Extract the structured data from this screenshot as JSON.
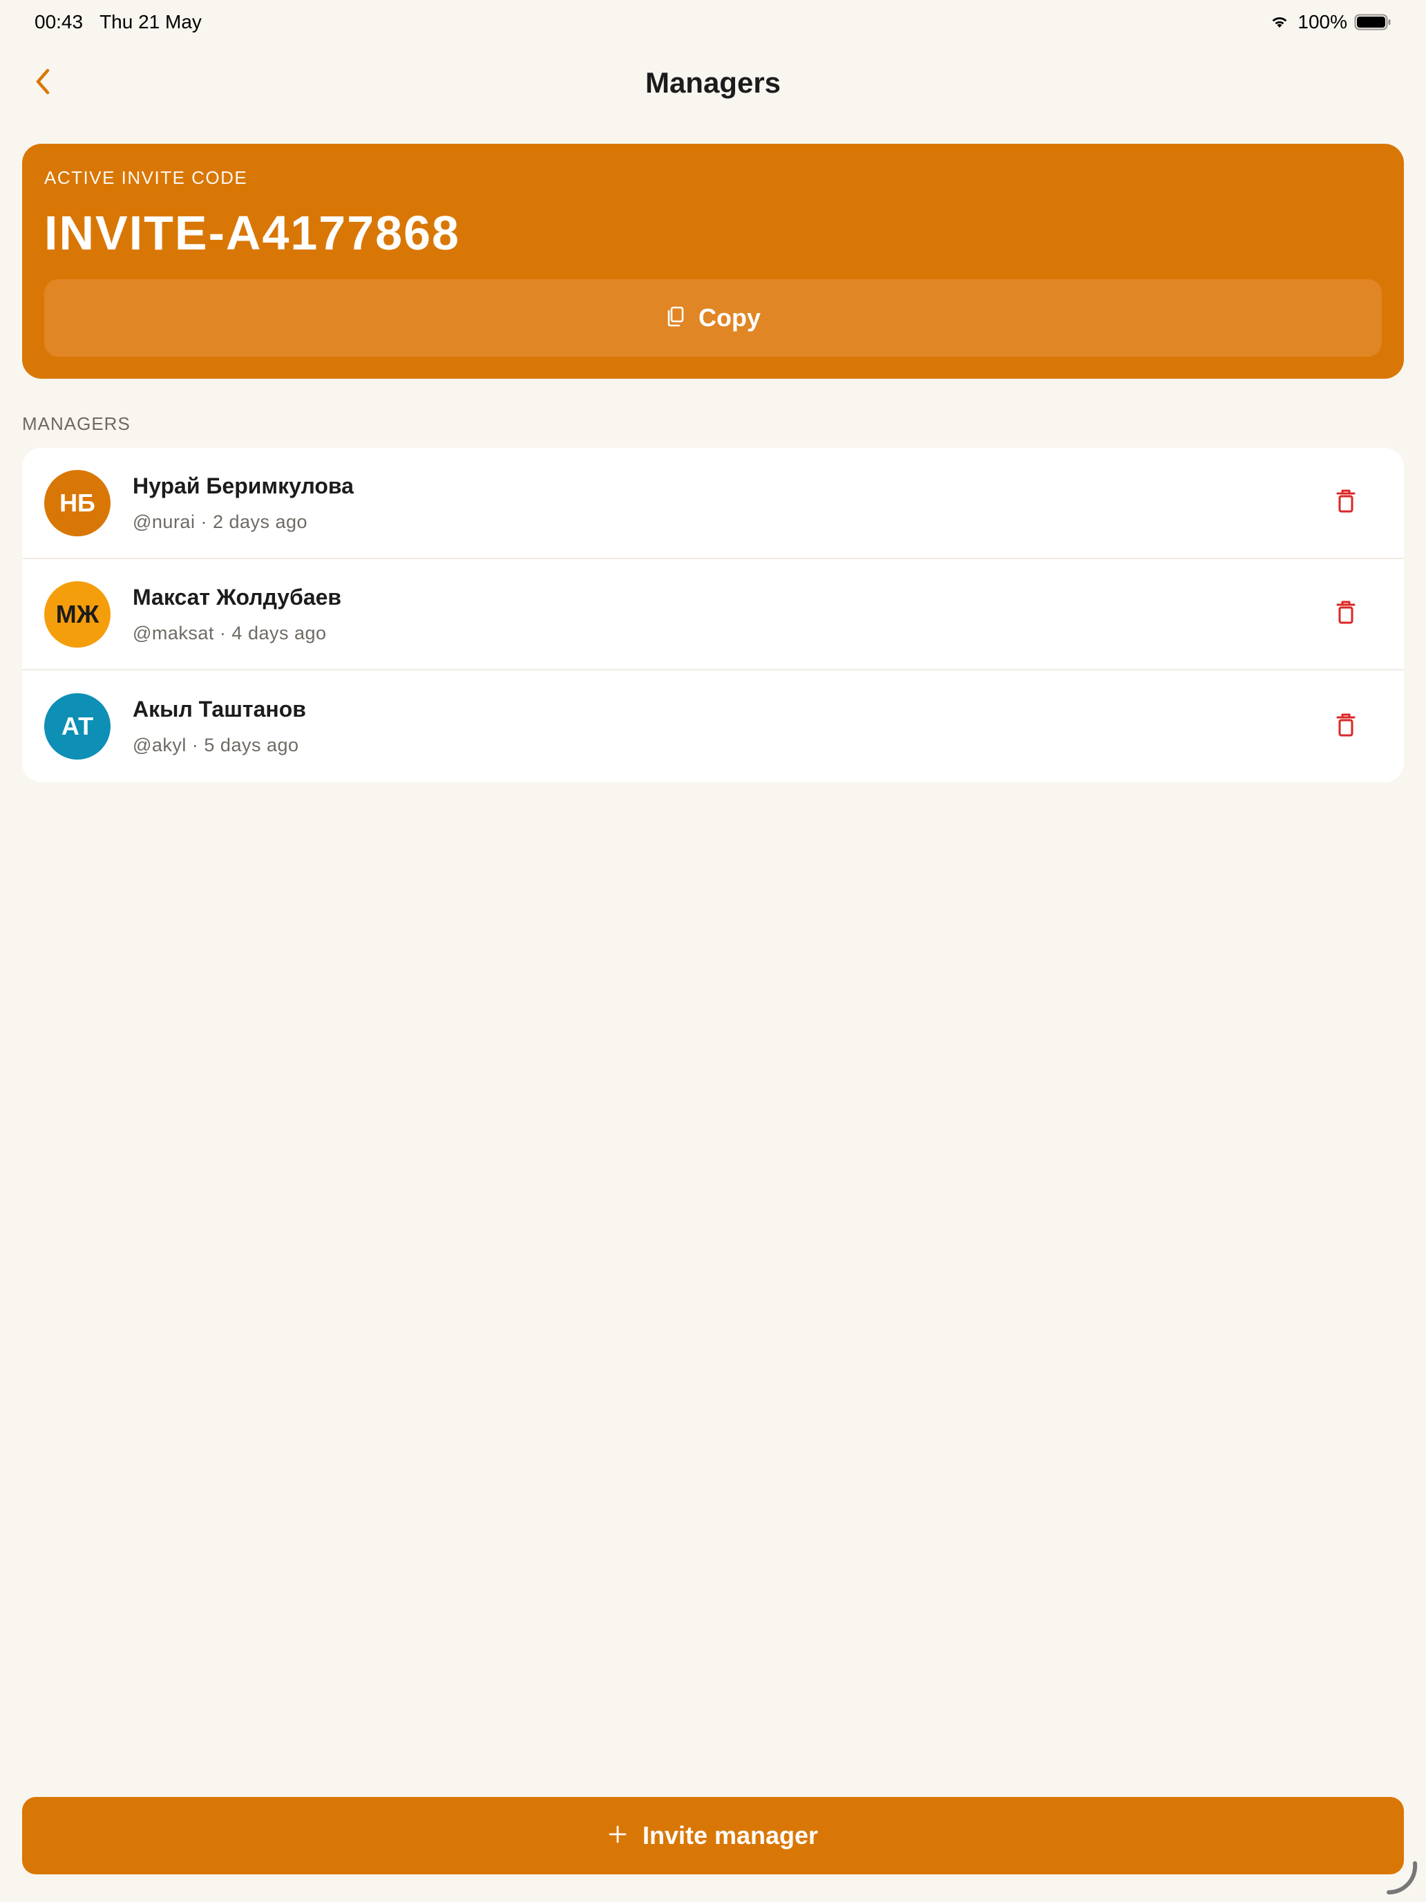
{
  "status_bar": {
    "time": "00:43",
    "date": "Thu 21 May",
    "battery": "100%",
    "icons": [
      "wifi-icon",
      "battery-icon"
    ]
  },
  "nav": {
    "title": "Managers",
    "back_icon": "chevron-left-icon"
  },
  "invite_card": {
    "label": "ACTIVE INVITE CODE",
    "code": "INVITE-A4177868",
    "copy_label": "Copy",
    "copy_icon": "copy-icon"
  },
  "managers_section": {
    "header": "MANAGERS",
    "items": [
      {
        "initials": "НБ",
        "name": "Нурай Беримкулова",
        "meta": "@nurai · 2 days ago",
        "avatar_color": "#d97706",
        "avatar_text_color": "#ffffff"
      },
      {
        "initials": "МЖ",
        "name": "Максат Жолдубаев",
        "meta": "@maksat · 4 days ago",
        "avatar_color": "#f59e0b",
        "avatar_text_color": "#1c1c1e"
      },
      {
        "initials": "АТ",
        "name": "Акыл Таштанов",
        "meta": "@akyl · 5 days ago",
        "avatar_color": "#0e8fb5",
        "avatar_text_color": "#ffffff"
      }
    ],
    "delete_icon": "trash-icon"
  },
  "footer": {
    "invite_label": "Invite manager",
    "invite_icon": "plus-icon"
  },
  "colors": {
    "accent": "#d97706",
    "danger": "#dc2626",
    "background": "#f9f6f0"
  }
}
